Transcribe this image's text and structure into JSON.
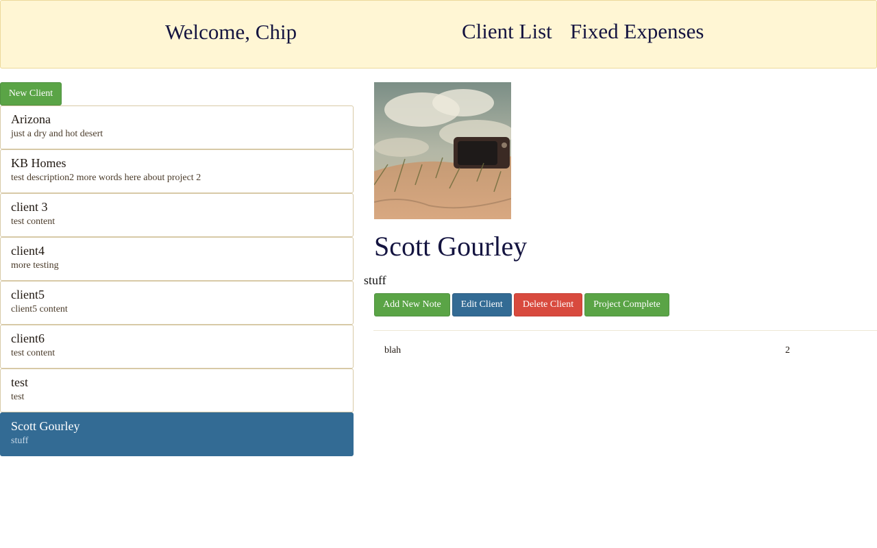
{
  "header": {
    "welcome": "Welcome, Chip",
    "nav": {
      "client_list": "Client List",
      "fixed_expenses": "Fixed Expenses"
    }
  },
  "sidebar": {
    "new_client_label": "New Client",
    "clients": [
      {
        "name": "Arizona",
        "description": "just a dry and hot desert",
        "active": false
      },
      {
        "name": "KB Homes",
        "description": "test description2 more words here about project 2",
        "active": false
      },
      {
        "name": "client 3",
        "description": "test content",
        "active": false
      },
      {
        "name": "client4",
        "description": "more testing",
        "active": false
      },
      {
        "name": "client5",
        "description": "client5 content",
        "active": false
      },
      {
        "name": "client6",
        "description": "test content",
        "active": false
      },
      {
        "name": "test",
        "description": "test",
        "active": false
      },
      {
        "name": "Scott Gourley",
        "description": "stuff",
        "active": true
      }
    ]
  },
  "detail": {
    "name": "Scott Gourley",
    "description": "stuff",
    "actions": {
      "add_note": "Add New Note",
      "edit": "Edit Client",
      "delete": "Delete Client",
      "complete": "Project Complete"
    },
    "notes": [
      {
        "text": "blah",
        "count": "2"
      }
    ]
  },
  "colors": {
    "header_bg": "#fff6d4",
    "accent_blue": "#336b94",
    "accent_green": "#5aa446",
    "accent_red": "#d84a3e",
    "title_navy": "#141440"
  }
}
